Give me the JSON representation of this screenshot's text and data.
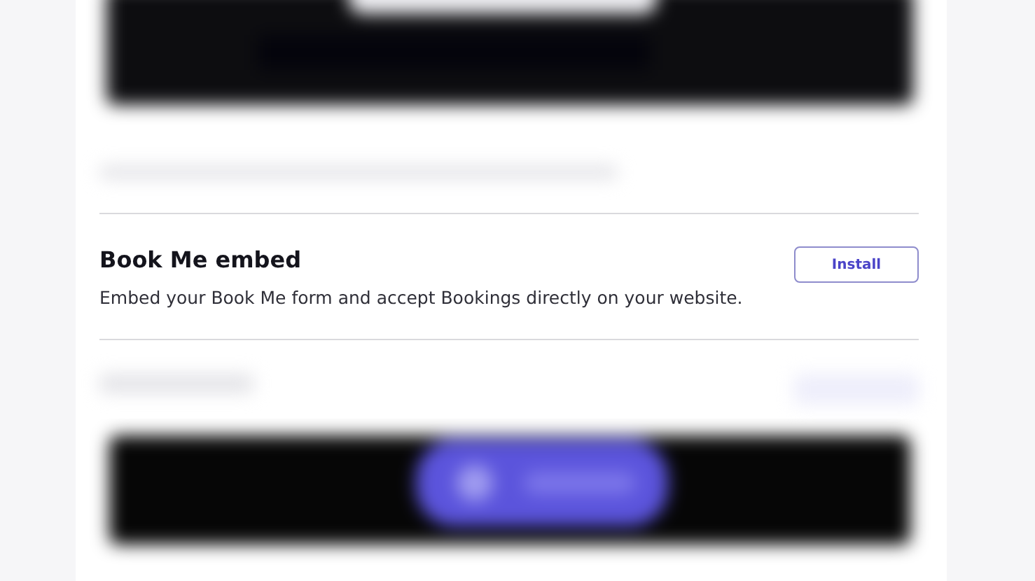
{
  "integration": {
    "title": "Book Me embed",
    "description": "Embed your Book Me form and accept Bookings directly on your website.",
    "button": {
      "label": "Install"
    }
  }
}
